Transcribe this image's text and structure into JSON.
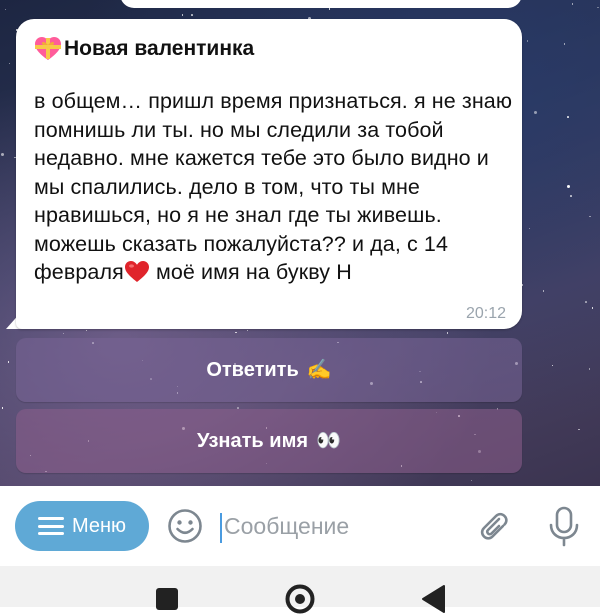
{
  "message": {
    "title": "Новая валентинка",
    "title_icon": "heart-with-ribbon-icon",
    "text_before_heart": "в общем… пришл время признаться. я не знаю помнишь ли ты. но мы следили за тобой недавно. мне кажется тебе это было видно и мы спалились. дело в том, что ты мне нравишься, но я не знал где ты живешь. можешь сказать пожалуйста?? и да, с 14 февраля",
    "inline_icon": "red-heart-icon",
    "text_after_heart": " моё имя на букву Н",
    "time": "20:12"
  },
  "keyboard": {
    "reply_label": "Ответить",
    "reply_emoji": "✍️",
    "reply_icon": "writing-hand-icon",
    "name_label": "Узнать имя",
    "name_emoji": "👀",
    "name_icon": "eyes-icon"
  },
  "input_bar": {
    "menu_label": "Меню",
    "placeholder": "Сообщение"
  },
  "colors": {
    "menu_button": "#5fa9d6",
    "cursor": "#4a9be0",
    "heart": "#e0242b"
  }
}
